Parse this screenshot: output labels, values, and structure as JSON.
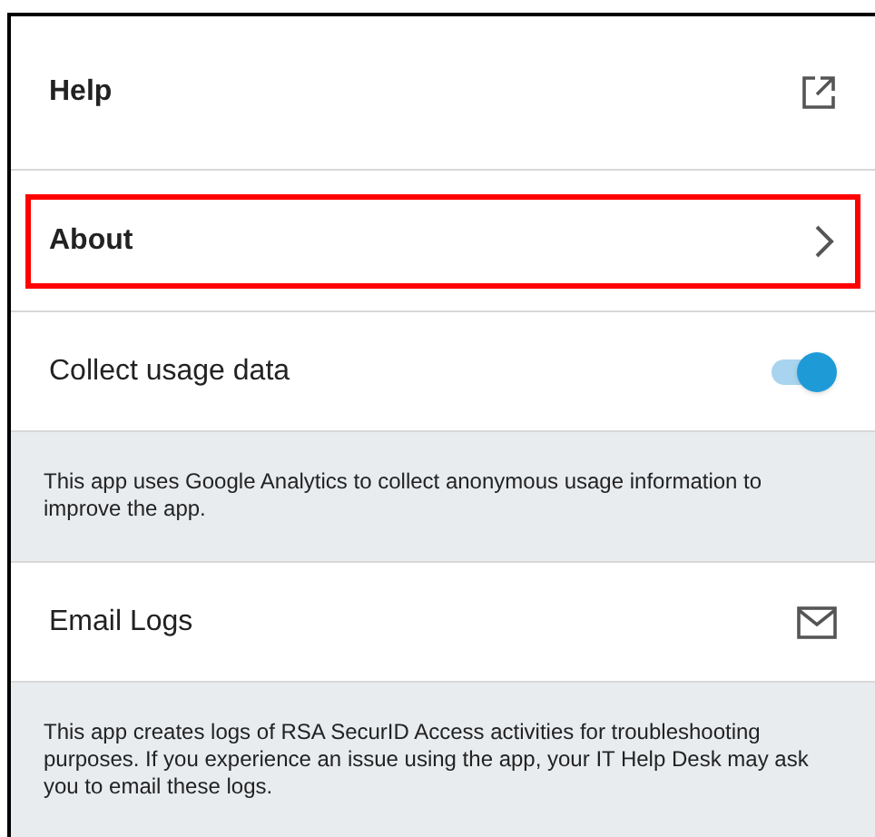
{
  "items": [
    {
      "kind": "link",
      "label": "Help",
      "highlighted": false
    },
    {
      "kind": "nav",
      "label": "About",
      "highlighted": true
    },
    {
      "kind": "toggle",
      "label": "Collect usage data",
      "on": true,
      "highlighted": false
    },
    {
      "kind": "note",
      "text": "This app uses Google Analytics to collect anonymous usage information to improve the app."
    },
    {
      "kind": "email",
      "label": "Email Logs",
      "highlighted": false
    },
    {
      "kind": "note",
      "text": "This app creates logs of RSA SecurID Access activities for troubleshooting purposes. If you experience an issue using the app, your IT Help Desk may ask you to email these logs."
    }
  ]
}
